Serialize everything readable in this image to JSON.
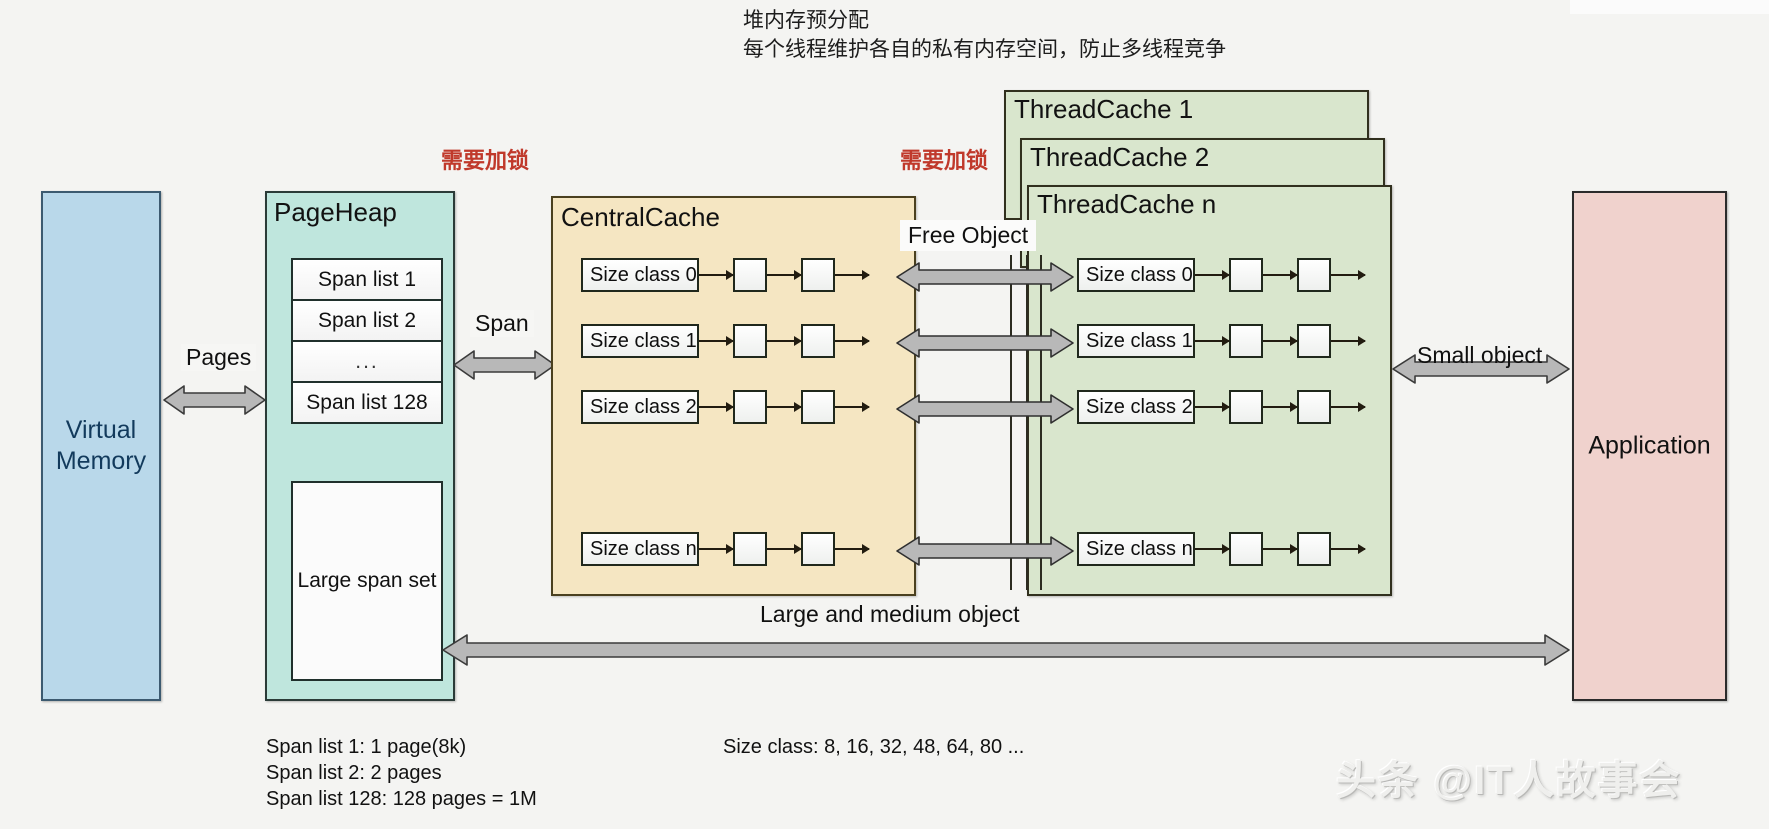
{
  "annotation": {
    "line1": "堆内存预分配",
    "line2": "每个线程维护各自的私有内存空间，防止多线程竞争"
  },
  "locks": {
    "pageheap_lock": "需要加锁",
    "centralcache_lock": "需要加锁"
  },
  "virtual_memory": {
    "label_line1": "Virtual",
    "label_line2": "Memory"
  },
  "pageheap": {
    "title": "PageHeap",
    "span_lists": [
      "Span list 1",
      "Span list 2",
      "...",
      "Span list 128"
    ],
    "large_span_set": "Large span set"
  },
  "central_cache": {
    "title": "CentralCache",
    "size_classes": [
      "Size class 0",
      "Size class 1",
      "Size class 2",
      "Size class n"
    ]
  },
  "thread_caches": {
    "titles": [
      "ThreadCache 1",
      "ThreadCache 2",
      "ThreadCache n"
    ],
    "size_classes": [
      "Size class 0",
      "Size class 1",
      "Size class 2",
      "Size class n"
    ]
  },
  "application": {
    "label": "Application"
  },
  "arrows": {
    "pages": "Pages",
    "span": "Span",
    "free_object": "Free Object",
    "small_object": "Small object",
    "large_and_medium_object": "Large and medium object"
  },
  "captions": {
    "span_legend_line1": "Span list 1: 1 page(8k)",
    "span_legend_line2": "Span list 2: 2 pages",
    "span_legend_line3": "Span list 128: 128 pages = 1M",
    "size_class_legend": "Size class: 8, 16, 32, 48, 64, 80 ..."
  },
  "watermark": {
    "text": "头条 @IT人故事会"
  },
  "colors": {
    "virtual_memory": "#b9d8ea",
    "pageheap": "#bfe6dd",
    "central_cache": "#f5e6c2",
    "thread_cache": "#d9e6cd",
    "application": "#f0d2cd",
    "lock_text": "#c0392b",
    "arrow_gray": "#b3b3b3"
  }
}
